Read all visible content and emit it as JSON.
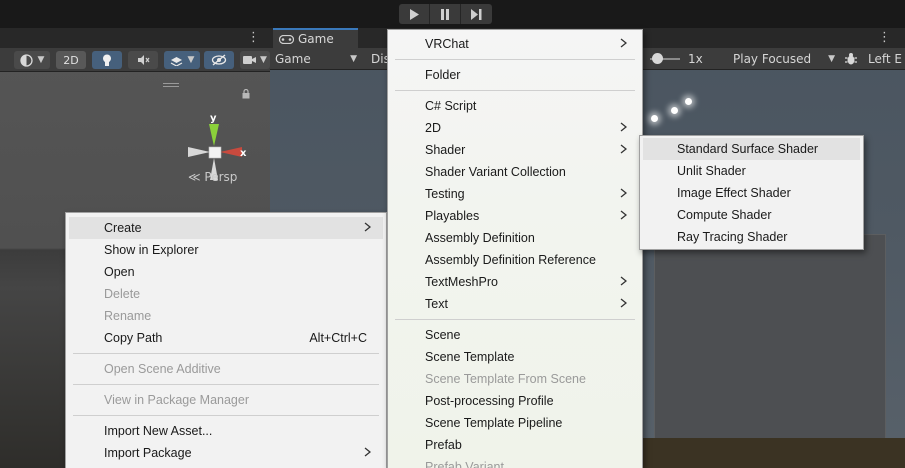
{
  "toolbar": {
    "play_icon": "play-icon",
    "pause_icon": "pause-icon",
    "step_icon": "step-icon"
  },
  "scene": {
    "btn_2d": "2D",
    "persp_label": "Persp",
    "axis_y": "y",
    "axis_x": "x"
  },
  "game": {
    "tab_label": "Game",
    "display_type": "Game",
    "display_label": "Dis",
    "scale_value": "1x",
    "play_mode": "Play Focused",
    "left_label": "Left E"
  },
  "menu_project": {
    "items": [
      {
        "label": "Create",
        "submenu": true,
        "highlighted": true
      },
      {
        "label": "Show in Explorer"
      },
      {
        "label": "Open"
      },
      {
        "label": "Delete",
        "disabled": true
      },
      {
        "label": "Rename",
        "disabled": true
      },
      {
        "label": "Copy Path",
        "shortcut": "Alt+Ctrl+C"
      },
      {
        "label": "Open Scene Additive",
        "disabled": true
      },
      {
        "label": "View in Package Manager",
        "disabled": true
      },
      {
        "label": "Import New Asset..."
      },
      {
        "label": "Import Package",
        "submenu": true
      }
    ]
  },
  "menu_create": {
    "items": [
      {
        "label": "VRChat",
        "submenu": true
      },
      {
        "label": "Folder"
      },
      {
        "label": "C# Script"
      },
      {
        "label": "2D",
        "submenu": true
      },
      {
        "label": "Shader",
        "submenu": true
      },
      {
        "label": "Shader Variant Collection"
      },
      {
        "label": "Testing",
        "submenu": true
      },
      {
        "label": "Playables",
        "submenu": true
      },
      {
        "label": "Assembly Definition"
      },
      {
        "label": "Assembly Definition Reference"
      },
      {
        "label": "TextMeshPro",
        "submenu": true
      },
      {
        "label": "Text",
        "submenu": true
      },
      {
        "label": "Scene"
      },
      {
        "label": "Scene Template"
      },
      {
        "label": "Scene Template From Scene",
        "disabled": true
      },
      {
        "label": "Post-processing Profile"
      },
      {
        "label": "Scene Template Pipeline"
      },
      {
        "label": "Prefab"
      },
      {
        "label": "Prefab Variant",
        "disabled": true
      }
    ]
  },
  "menu_shader": {
    "items": [
      {
        "label": "Standard Surface Shader",
        "highlighted": true
      },
      {
        "label": "Unlit Shader"
      },
      {
        "label": "Image Effect Shader"
      },
      {
        "label": "Compute Shader"
      },
      {
        "label": "Ray Tracing Shader"
      }
    ]
  },
  "colors": {
    "accent": "#3a79bb",
    "menu_bg": "#f2f2f2",
    "highlight": "#e2e2e2",
    "disabled_text": "#9a9a9a"
  }
}
